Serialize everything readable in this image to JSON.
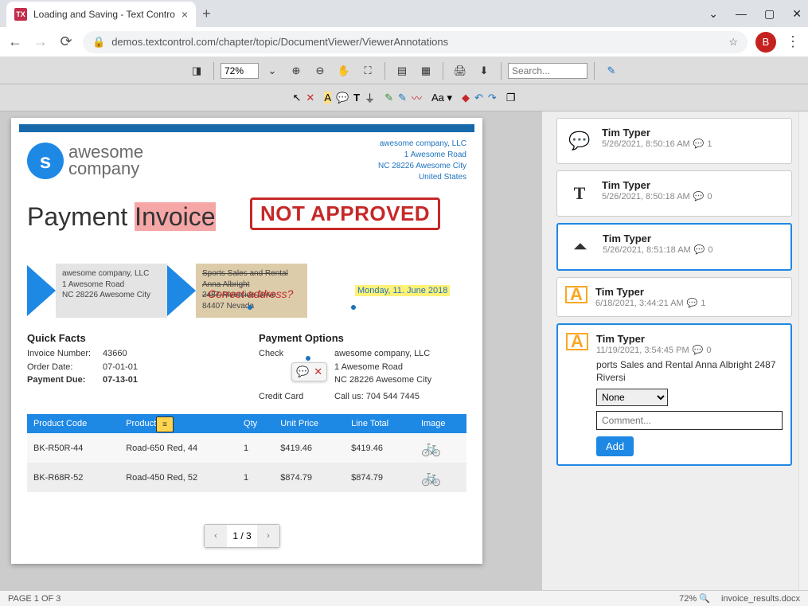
{
  "browser": {
    "tab_title": "Loading and Saving - Text Contro",
    "url": "demos.textcontrol.com/chapter/topic/DocumentViewer/ViewerAnnotations",
    "profile_initial": "B"
  },
  "toolbar": {
    "zoom": "72%",
    "search_placeholder": "Search...",
    "font_label": "Aa"
  },
  "document": {
    "company_logo_letter": "s",
    "company_name_top": "awesome",
    "company_name_bottom": "company",
    "company_addr": {
      "l1": "awesome company, LLC",
      "l2": "1 Awesome Road",
      "l3": "NC 28226 Awesome City",
      "l4": "United States"
    },
    "stamp": "NOT APPROVED",
    "title_a": "Payment ",
    "title_b": "Invoice",
    "correct_addr_label": "Correct address?",
    "date_highlight": "Monday, 11. June 2018",
    "from_addr": {
      "l1": "awesome company, LLC",
      "l2": "1 Awesome Road",
      "l3": "NC 28226 Awesome City"
    },
    "to_addr": {
      "l1": "Sports Sales and Rental",
      "l2": "Anna Albright",
      "l3": "2487 Riverside Drive",
      "l4": "84407 Nevada"
    },
    "facts_title": "Quick Facts",
    "facts": {
      "invoice_no_label": "Invoice Number:",
      "invoice_no": "43660",
      "order_date_label": "Order Date:",
      "order_date": "07-01-01",
      "payment_due_label": "Payment Due:",
      "payment_due": "07-13-01"
    },
    "payopt_title": "Payment Options",
    "payopt": {
      "check_label": "Check",
      "check_l1": "awesome company, LLC",
      "check_l2": "1 Awesome Road",
      "check_l3": "NC 28226 Awesome City",
      "cc_label": "Credit Card",
      "cc_val": "Call us: 704 544 7445"
    },
    "table": {
      "headers": [
        "Product Code",
        "Product",
        "Qty",
        "Unit Price",
        "Line Total",
        "Image"
      ],
      "rows": [
        {
          "code": "BK-R50R-44",
          "name": "Road-650 Red, 44",
          "qty": "1",
          "unit": "$419.46",
          "total": "$419.46"
        },
        {
          "code": "BK-R68R-52",
          "name": "Road-450 Red, 52",
          "qty": "1",
          "unit": "$874.79",
          "total": "$874.79"
        }
      ]
    },
    "pager": "1 / 3"
  },
  "annotations": [
    {
      "user": "Tim Typer",
      "time": "5/26/2021, 8:50:16 AM",
      "count": "1",
      "icon": "comment",
      "active": false
    },
    {
      "user": "Tim Typer",
      "time": "5/26/2021, 8:50:18 AM",
      "count": "0",
      "icon": "text",
      "active": false
    },
    {
      "user": "Tim Typer",
      "time": "5/26/2021, 8:51:18 AM",
      "count": "0",
      "icon": "stamp",
      "active": true
    },
    {
      "user": "Tim Typer",
      "time": "6/18/2021, 3:44:21 AM",
      "count": "1",
      "icon": "highlight",
      "active": false
    }
  ],
  "detail": {
    "user": "Tim Typer",
    "time": "11/19/2021, 3:54:45 PM",
    "count": "0",
    "text": "ports Sales and Rental Anna Albright 2487 Riversi",
    "status": "None",
    "comment_placeholder": "Comment...",
    "add_label": "Add"
  },
  "status": {
    "page": "PAGE 1 OF 3",
    "zoom": "72%",
    "filename": "invoice_results.docx"
  }
}
